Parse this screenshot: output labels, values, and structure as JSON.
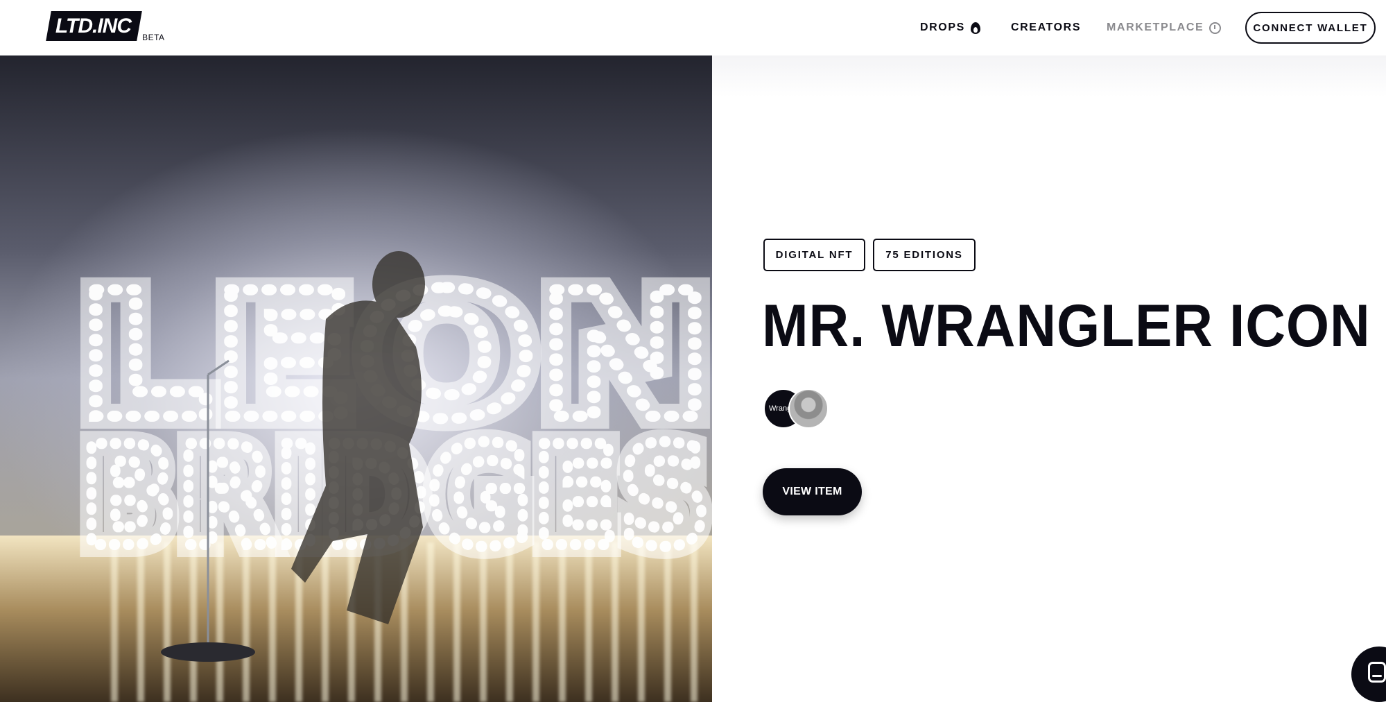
{
  "header": {
    "logo_text": "LTD.INC",
    "beta_label": "BETA",
    "nav": [
      {
        "label": "DROPS",
        "icon": "flame-icon"
      },
      {
        "label": "CREATORS"
      },
      {
        "label": "MARKETPLACE",
        "icon": "stopwatch-icon"
      }
    ],
    "connect_wallet_label": "CONNECT WALLET"
  },
  "hero": {
    "image_sign_line1": "LEON",
    "image_sign_line2": "BRIDGES"
  },
  "item": {
    "tags": [
      "DIGITAL NFT",
      "75 EDITIONS"
    ],
    "title": "MR. WRANGLER ICON",
    "brand_avatar_text": "Wrang",
    "view_button_label": "VIEW ITEM"
  },
  "colors": {
    "primary": "#0b0b14",
    "muted_nav": "#8a8a8e",
    "background": "#ffffff"
  }
}
